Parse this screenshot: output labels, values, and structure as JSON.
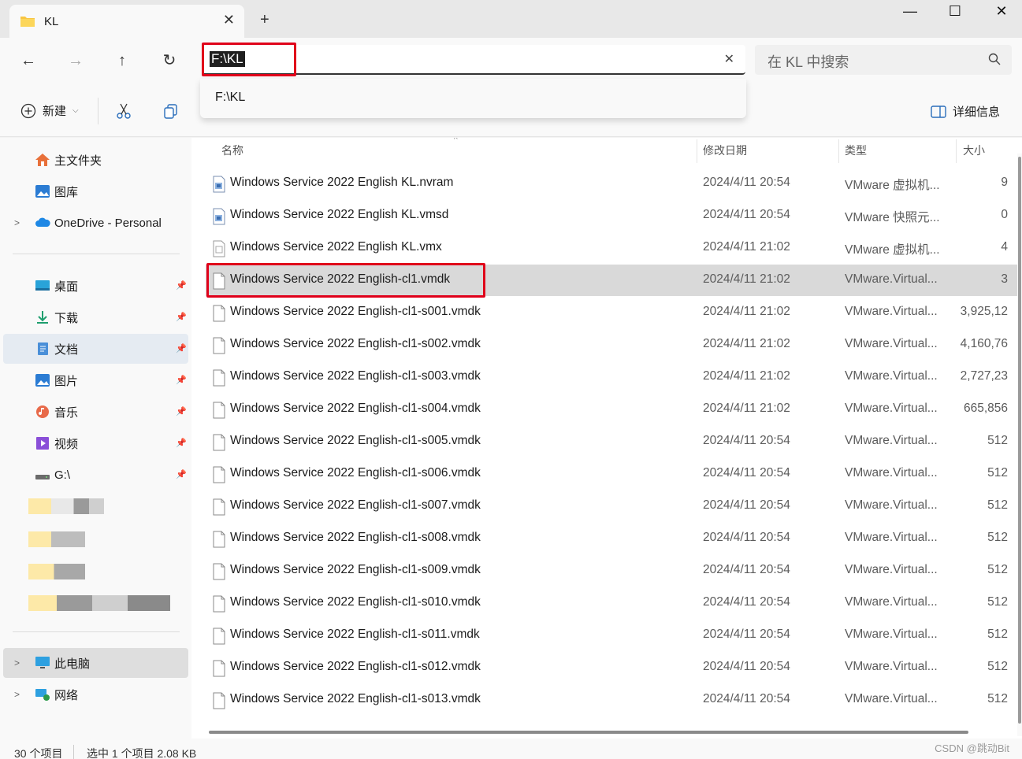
{
  "window": {
    "tab_title": "KL",
    "tab_close": "✕",
    "new_tab": "+",
    "minimize": "—",
    "maximize": "☐",
    "close": "✕"
  },
  "nav": {
    "back": "←",
    "forward": "→",
    "up": "↑",
    "refresh": "↻"
  },
  "address": {
    "value": "F:\\KL",
    "clear": "✕",
    "suggestion": "F:\\KL"
  },
  "search": {
    "placeholder": "在 KL 中搜索"
  },
  "toolbar": {
    "new_label": "新建",
    "details_label": "详细信息"
  },
  "sidebar": {
    "home": "主文件夹",
    "gallery": "图库",
    "onedrive": "OneDrive - Personal",
    "desktop": "桌面",
    "downloads": "下载",
    "documents": "文档",
    "pictures": "图片",
    "music": "音乐",
    "videos": "视频",
    "drive_g": "G:\\",
    "this_pc": "此电脑",
    "network": "网络"
  },
  "columns": {
    "name": "名称",
    "modified": "修改日期",
    "type": "类型",
    "size": "大小"
  },
  "files": [
    {
      "name": "Windows Service 2022 English KL.nvram",
      "date": "2024/4/11 20:54",
      "type": "VMware 虚拟机...",
      "size": "9"
    },
    {
      "name": "Windows Service 2022 English KL.vmsd",
      "date": "2024/4/11 20:54",
      "type": "VMware 快照元...",
      "size": "0"
    },
    {
      "name": "Windows Service 2022 English KL.vmx",
      "date": "2024/4/11 21:02",
      "type": "VMware 虚拟机...",
      "size": "4"
    },
    {
      "name": "Windows Service 2022 English-cl1.vmdk",
      "date": "2024/4/11 21:02",
      "type": "VMware.Virtual...",
      "size": "3"
    },
    {
      "name": "Windows Service 2022 English-cl1-s001.vmdk",
      "date": "2024/4/11 21:02",
      "type": "VMware.Virtual...",
      "size": "3,925,12"
    },
    {
      "name": "Windows Service 2022 English-cl1-s002.vmdk",
      "date": "2024/4/11 21:02",
      "type": "VMware.Virtual...",
      "size": "4,160,76"
    },
    {
      "name": "Windows Service 2022 English-cl1-s003.vmdk",
      "date": "2024/4/11 21:02",
      "type": "VMware.Virtual...",
      "size": "2,727,23"
    },
    {
      "name": "Windows Service 2022 English-cl1-s004.vmdk",
      "date": "2024/4/11 21:02",
      "type": "VMware.Virtual...",
      "size": "665,856"
    },
    {
      "name": "Windows Service 2022 English-cl1-s005.vmdk",
      "date": "2024/4/11 20:54",
      "type": "VMware.Virtual...",
      "size": "512"
    },
    {
      "name": "Windows Service 2022 English-cl1-s006.vmdk",
      "date": "2024/4/11 20:54",
      "type": "VMware.Virtual...",
      "size": "512"
    },
    {
      "name": "Windows Service 2022 English-cl1-s007.vmdk",
      "date": "2024/4/11 20:54",
      "type": "VMware.Virtual...",
      "size": "512"
    },
    {
      "name": "Windows Service 2022 English-cl1-s008.vmdk",
      "date": "2024/4/11 20:54",
      "type": "VMware.Virtual...",
      "size": "512"
    },
    {
      "name": "Windows Service 2022 English-cl1-s009.vmdk",
      "date": "2024/4/11 20:54",
      "type": "VMware.Virtual...",
      "size": "512"
    },
    {
      "name": "Windows Service 2022 English-cl1-s010.vmdk",
      "date": "2024/4/11 20:54",
      "type": "VMware.Virtual...",
      "size": "512"
    },
    {
      "name": "Windows Service 2022 English-cl1-s011.vmdk",
      "date": "2024/4/11 20:54",
      "type": "VMware.Virtual...",
      "size": "512"
    },
    {
      "name": "Windows Service 2022 English-cl1-s012.vmdk",
      "date": "2024/4/11 20:54",
      "type": "VMware.Virtual...",
      "size": "512"
    },
    {
      "name": "Windows Service 2022 English-cl1-s013.vmdk",
      "date": "2024/4/11 20:54",
      "type": "VMware.Virtual...",
      "size": "512"
    }
  ],
  "status": {
    "count": "30 个项目",
    "selection": "选中 1 个项目  2.08 KB",
    "watermark": "CSDN @跳动Bit"
  },
  "colors": {
    "highlight_red": "#e0001a",
    "selection_gray": "#d9d9d9",
    "accent_blue": "#0067c0"
  }
}
